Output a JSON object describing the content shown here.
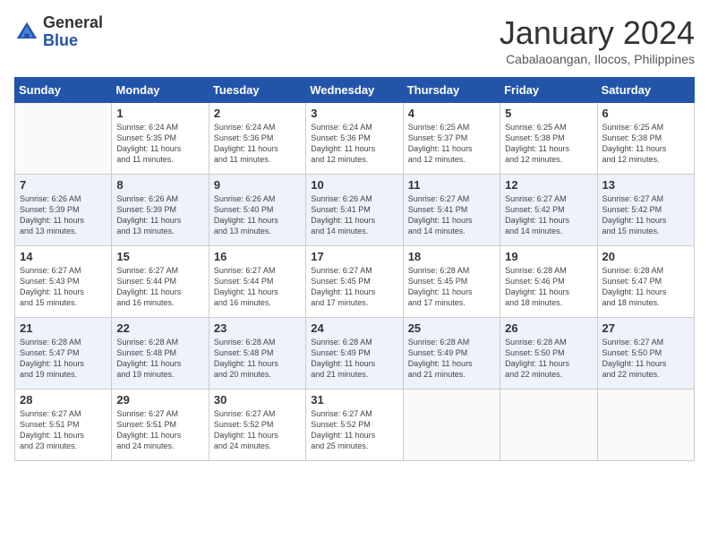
{
  "header": {
    "logo_general": "General",
    "logo_blue": "Blue",
    "month_title": "January 2024",
    "location": "Cabalaoangan, Ilocos, Philippines"
  },
  "weekdays": [
    "Sunday",
    "Monday",
    "Tuesday",
    "Wednesday",
    "Thursday",
    "Friday",
    "Saturday"
  ],
  "weeks": [
    [
      {
        "day": "",
        "info": ""
      },
      {
        "day": "1",
        "info": "Sunrise: 6:24 AM\nSunset: 5:35 PM\nDaylight: 11 hours\nand 11 minutes."
      },
      {
        "day": "2",
        "info": "Sunrise: 6:24 AM\nSunset: 5:36 PM\nDaylight: 11 hours\nand 11 minutes."
      },
      {
        "day": "3",
        "info": "Sunrise: 6:24 AM\nSunset: 5:36 PM\nDaylight: 11 hours\nand 12 minutes."
      },
      {
        "day": "4",
        "info": "Sunrise: 6:25 AM\nSunset: 5:37 PM\nDaylight: 11 hours\nand 12 minutes."
      },
      {
        "day": "5",
        "info": "Sunrise: 6:25 AM\nSunset: 5:38 PM\nDaylight: 11 hours\nand 12 minutes."
      },
      {
        "day": "6",
        "info": "Sunrise: 6:25 AM\nSunset: 5:38 PM\nDaylight: 11 hours\nand 12 minutes."
      }
    ],
    [
      {
        "day": "7",
        "info": "Sunrise: 6:26 AM\nSunset: 5:39 PM\nDaylight: 11 hours\nand 13 minutes."
      },
      {
        "day": "8",
        "info": "Sunrise: 6:26 AM\nSunset: 5:39 PM\nDaylight: 11 hours\nand 13 minutes."
      },
      {
        "day": "9",
        "info": "Sunrise: 6:26 AM\nSunset: 5:40 PM\nDaylight: 11 hours\nand 13 minutes."
      },
      {
        "day": "10",
        "info": "Sunrise: 6:26 AM\nSunset: 5:41 PM\nDaylight: 11 hours\nand 14 minutes."
      },
      {
        "day": "11",
        "info": "Sunrise: 6:27 AM\nSunset: 5:41 PM\nDaylight: 11 hours\nand 14 minutes."
      },
      {
        "day": "12",
        "info": "Sunrise: 6:27 AM\nSunset: 5:42 PM\nDaylight: 11 hours\nand 14 minutes."
      },
      {
        "day": "13",
        "info": "Sunrise: 6:27 AM\nSunset: 5:42 PM\nDaylight: 11 hours\nand 15 minutes."
      }
    ],
    [
      {
        "day": "14",
        "info": "Sunrise: 6:27 AM\nSunset: 5:43 PM\nDaylight: 11 hours\nand 15 minutes."
      },
      {
        "day": "15",
        "info": "Sunrise: 6:27 AM\nSunset: 5:44 PM\nDaylight: 11 hours\nand 16 minutes."
      },
      {
        "day": "16",
        "info": "Sunrise: 6:27 AM\nSunset: 5:44 PM\nDaylight: 11 hours\nand 16 minutes."
      },
      {
        "day": "17",
        "info": "Sunrise: 6:27 AM\nSunset: 5:45 PM\nDaylight: 11 hours\nand 17 minutes."
      },
      {
        "day": "18",
        "info": "Sunrise: 6:28 AM\nSunset: 5:45 PM\nDaylight: 11 hours\nand 17 minutes."
      },
      {
        "day": "19",
        "info": "Sunrise: 6:28 AM\nSunset: 5:46 PM\nDaylight: 11 hours\nand 18 minutes."
      },
      {
        "day": "20",
        "info": "Sunrise: 6:28 AM\nSunset: 5:47 PM\nDaylight: 11 hours\nand 18 minutes."
      }
    ],
    [
      {
        "day": "21",
        "info": "Sunrise: 6:28 AM\nSunset: 5:47 PM\nDaylight: 11 hours\nand 19 minutes."
      },
      {
        "day": "22",
        "info": "Sunrise: 6:28 AM\nSunset: 5:48 PM\nDaylight: 11 hours\nand 19 minutes."
      },
      {
        "day": "23",
        "info": "Sunrise: 6:28 AM\nSunset: 5:48 PM\nDaylight: 11 hours\nand 20 minutes."
      },
      {
        "day": "24",
        "info": "Sunrise: 6:28 AM\nSunset: 5:49 PM\nDaylight: 11 hours\nand 21 minutes."
      },
      {
        "day": "25",
        "info": "Sunrise: 6:28 AM\nSunset: 5:49 PM\nDaylight: 11 hours\nand 21 minutes."
      },
      {
        "day": "26",
        "info": "Sunrise: 6:28 AM\nSunset: 5:50 PM\nDaylight: 11 hours\nand 22 minutes."
      },
      {
        "day": "27",
        "info": "Sunrise: 6:27 AM\nSunset: 5:50 PM\nDaylight: 11 hours\nand 22 minutes."
      }
    ],
    [
      {
        "day": "28",
        "info": "Sunrise: 6:27 AM\nSunset: 5:51 PM\nDaylight: 11 hours\nand 23 minutes."
      },
      {
        "day": "29",
        "info": "Sunrise: 6:27 AM\nSunset: 5:51 PM\nDaylight: 11 hours\nand 24 minutes."
      },
      {
        "day": "30",
        "info": "Sunrise: 6:27 AM\nSunset: 5:52 PM\nDaylight: 11 hours\nand 24 minutes."
      },
      {
        "day": "31",
        "info": "Sunrise: 6:27 AM\nSunset: 5:52 PM\nDaylight: 11 hours\nand 25 minutes."
      },
      {
        "day": "",
        "info": ""
      },
      {
        "day": "",
        "info": ""
      },
      {
        "day": "",
        "info": ""
      }
    ]
  ]
}
